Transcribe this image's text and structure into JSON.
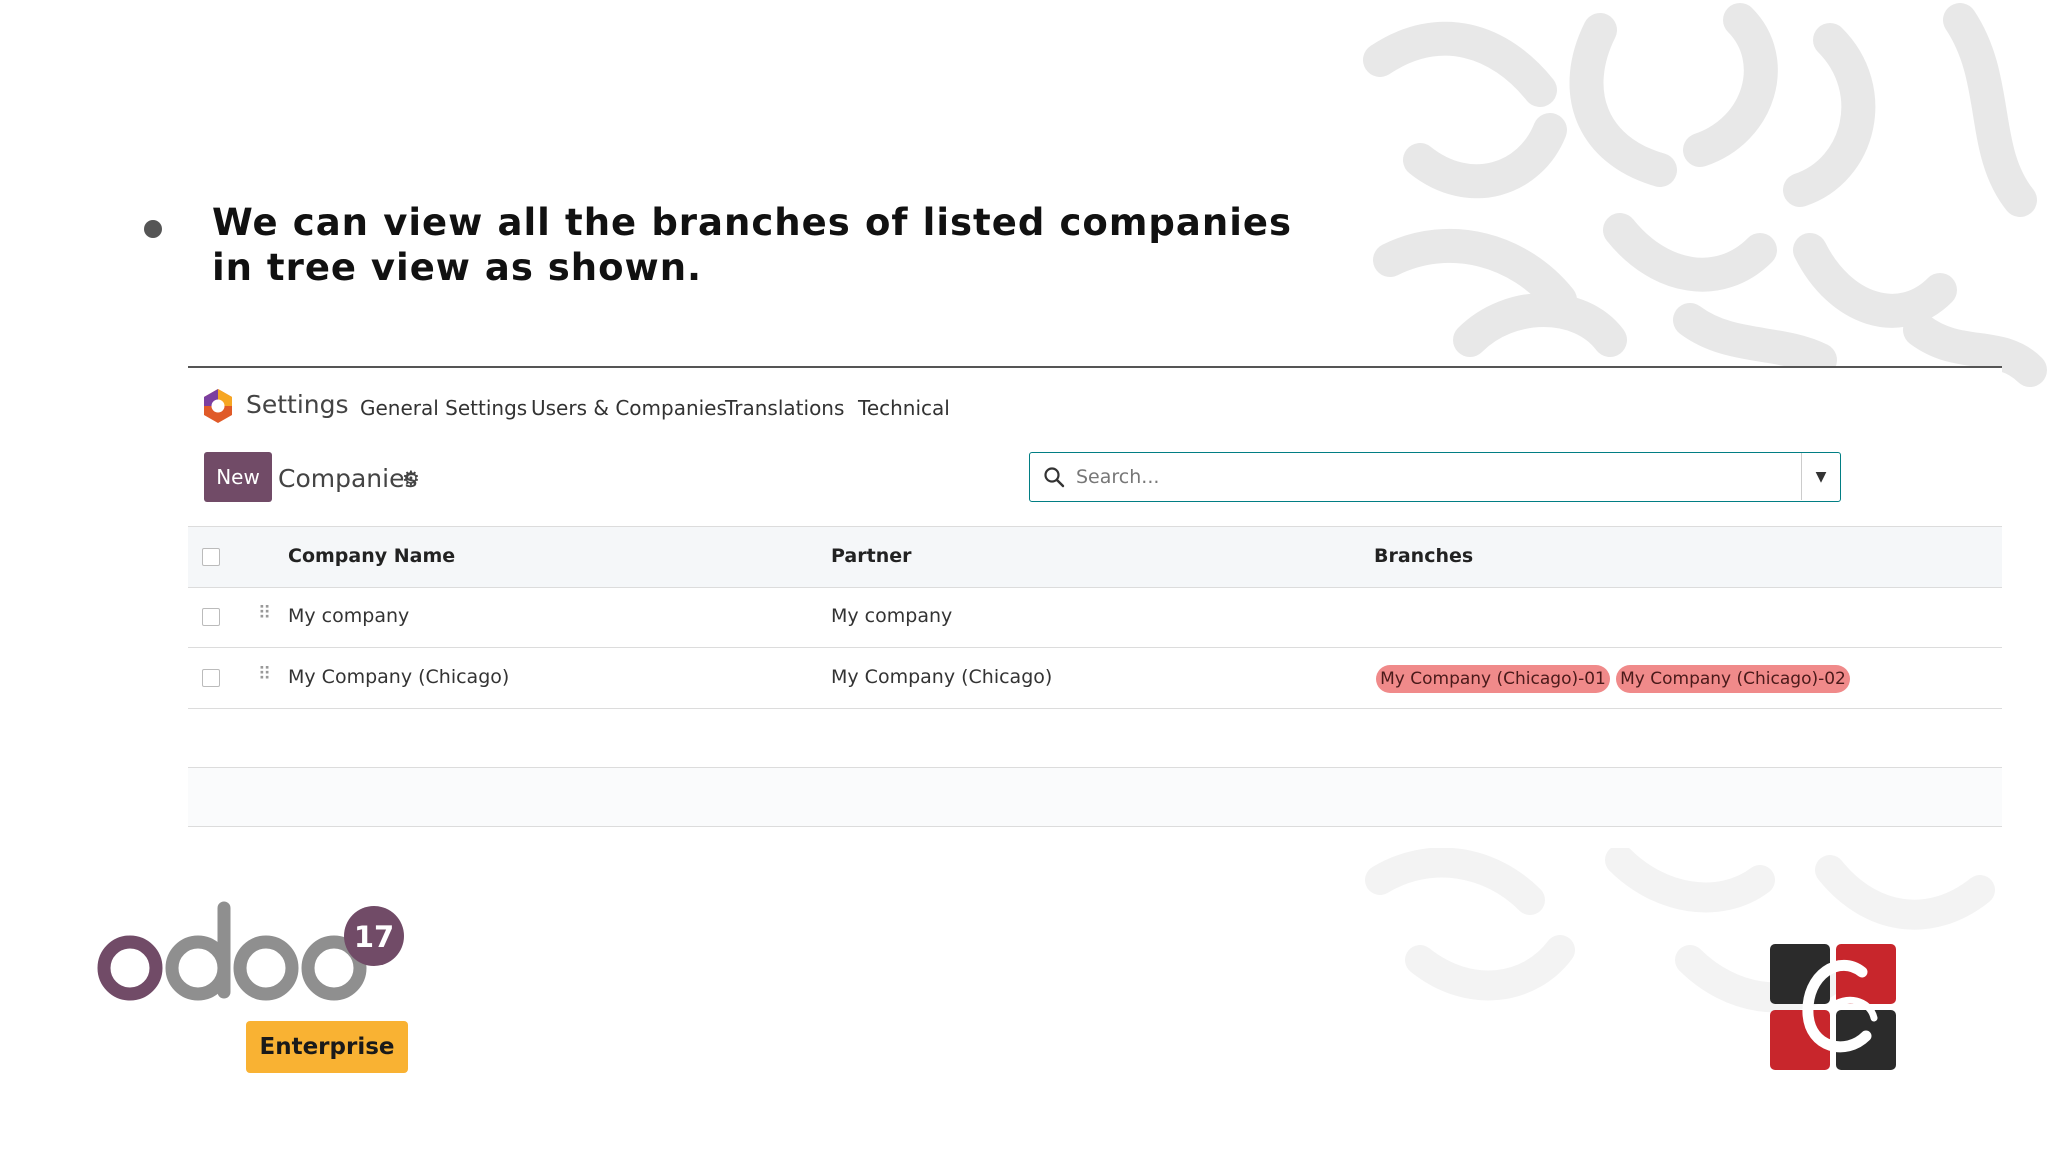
{
  "slide": {
    "bullet_text": "We can view all the branches of listed companies in tree view as shown."
  },
  "app": {
    "name": "Settings",
    "menu": [
      "General Settings",
      "Users & Companies",
      "Translations",
      "Technical"
    ]
  },
  "control_panel": {
    "new_label": "New",
    "title": "Companies",
    "search_placeholder": "Search..."
  },
  "table": {
    "headers": [
      "Company Name",
      "Partner",
      "Branches"
    ],
    "rows": [
      {
        "company": "My company",
        "partner": "My company",
        "branches": []
      },
      {
        "company": "My Company (Chicago)",
        "partner": "My Company (Chicago)",
        "branches": [
          "My Company (Chicago)-01",
          "My Company (Chicago)-02"
        ]
      }
    ]
  },
  "branding": {
    "odoo_wordmark": "odoo",
    "version_badge": "17",
    "edition_label": "Enterprise"
  },
  "colors": {
    "primary": "#714b67",
    "search_border": "#017e84",
    "branch_tag": "#f08a8a",
    "enterprise_badge": "#f9b233"
  }
}
